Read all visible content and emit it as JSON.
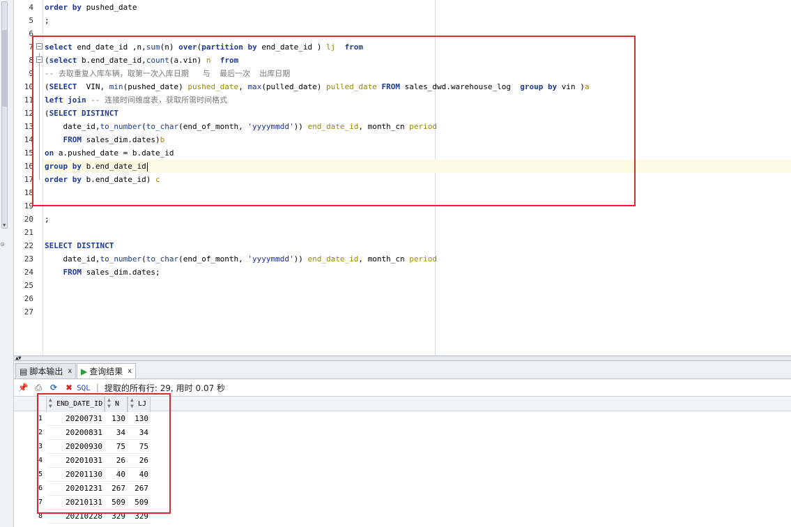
{
  "editor": {
    "lines": [
      {
        "no": "4",
        "tokens": [
          [
            "kw",
            "order by"
          ],
          [
            "t",
            " pushed_date"
          ]
        ]
      },
      {
        "no": "5",
        "tokens": [
          [
            "t",
            ";"
          ]
        ]
      },
      {
        "no": "6",
        "tokens": []
      },
      {
        "no": "7",
        "tokens": [
          [
            "kw",
            "select"
          ],
          [
            "t",
            " end_date_id ,n,"
          ],
          [
            "fn",
            "sum"
          ],
          [
            "t",
            "(n) "
          ],
          [
            "kw",
            "over"
          ],
          [
            "t",
            "("
          ],
          [
            "kw",
            "partition by"
          ],
          [
            "t",
            " end_date_id ) "
          ],
          [
            "al",
            "lj"
          ],
          [
            "t",
            "  "
          ],
          [
            "kw",
            "from"
          ]
        ]
      },
      {
        "no": "8",
        "tokens": [
          [
            "t",
            "("
          ],
          [
            "kw",
            "select"
          ],
          [
            "t",
            " b.end_date_id,"
          ],
          [
            "fn",
            "count"
          ],
          [
            "t",
            "(a.vin) "
          ],
          [
            "al",
            "n"
          ],
          [
            "t",
            "  "
          ],
          [
            "kw",
            "from"
          ]
        ]
      },
      {
        "no": "9",
        "tokens": [
          [
            "cm",
            "-- 去取重复入库车辆，取第一次入库日期   与  最后一次  出库日期"
          ]
        ]
      },
      {
        "no": "10",
        "tokens": [
          [
            "t",
            "("
          ],
          [
            "kw",
            "SELECT"
          ],
          [
            "t",
            "  VIN, "
          ],
          [
            "fn",
            "min"
          ],
          [
            "t",
            "(pushed_date) "
          ],
          [
            "al",
            "pushed_date"
          ],
          [
            "t",
            ", "
          ],
          [
            "fn",
            "max"
          ],
          [
            "t",
            "(pulled_date) "
          ],
          [
            "al",
            "pulled_date"
          ],
          [
            "t",
            " "
          ],
          [
            "kw",
            "FROM"
          ],
          [
            "t",
            " sales_dwd.warehouse_log  "
          ],
          [
            "kw",
            "group by"
          ],
          [
            "t",
            " vin )"
          ],
          [
            "al",
            "a"
          ]
        ]
      },
      {
        "no": "11",
        "tokens": [
          [
            "kw",
            "left join"
          ],
          [
            "t",
            " "
          ],
          [
            "cm",
            "-- 连接时间维度表，获取所需时间格式"
          ]
        ]
      },
      {
        "no": "12",
        "tokens": [
          [
            "t",
            "("
          ],
          [
            "kw",
            "SELECT DISTINCT"
          ]
        ]
      },
      {
        "no": "13",
        "tokens": [
          [
            "t",
            "    date_id,"
          ],
          [
            "fn",
            "to_number"
          ],
          [
            "t",
            "("
          ],
          [
            "fn",
            "to_char"
          ],
          [
            "t",
            "(end_of_month, "
          ],
          [
            "st",
            "'yyyymmdd'"
          ],
          [
            "t",
            ")) "
          ],
          [
            "al",
            "end_date_id"
          ],
          [
            "t",
            ", month_cn "
          ],
          [
            "al",
            "period"
          ]
        ]
      },
      {
        "no": "14",
        "tokens": [
          [
            "t",
            "    "
          ],
          [
            "kw",
            "FROM"
          ],
          [
            "t",
            " sales_dim.dates)"
          ],
          [
            "al",
            "b"
          ]
        ]
      },
      {
        "no": "15",
        "tokens": [
          [
            "kw",
            "on"
          ],
          [
            "t",
            " a.pushed_date = b.date_id"
          ]
        ]
      },
      {
        "no": "16",
        "tokens": [
          [
            "kw",
            "group by"
          ],
          [
            "t",
            " b.end_date_id"
          ]
        ]
      },
      {
        "no": "17",
        "tokens": [
          [
            "kw",
            "order by"
          ],
          [
            "t",
            " b.end_date_id) "
          ],
          [
            "al",
            "c"
          ]
        ]
      },
      {
        "no": "18",
        "tokens": []
      },
      {
        "no": "19",
        "tokens": []
      },
      {
        "no": "20",
        "tokens": [
          [
            "t",
            ";"
          ]
        ]
      },
      {
        "no": "21",
        "tokens": []
      },
      {
        "no": "22",
        "tokens": [
          [
            "kw",
            "SELECT DISTINCT"
          ]
        ]
      },
      {
        "no": "23",
        "tokens": [
          [
            "t",
            "    date_id,"
          ],
          [
            "fn",
            "to_number"
          ],
          [
            "t",
            "("
          ],
          [
            "fn",
            "to_char"
          ],
          [
            "t",
            "(end_of_month, "
          ],
          [
            "st",
            "'yyyymmdd'"
          ],
          [
            "t",
            ")) "
          ],
          [
            "al",
            "end_date_id"
          ],
          [
            "t",
            ", month_cn "
          ],
          [
            "al",
            "period"
          ]
        ]
      },
      {
        "no": "24",
        "tokens": [
          [
            "t",
            "    "
          ],
          [
            "kw",
            "FROM"
          ],
          [
            "t",
            " sales_dim.dates;"
          ]
        ]
      },
      {
        "no": "25",
        "tokens": []
      },
      {
        "no": "26",
        "tokens": []
      },
      {
        "no": "27",
        "tokens": []
      }
    ]
  },
  "tabs": {
    "script_output": "脚本输出",
    "query_result": "查询结果",
    "close": "x"
  },
  "toolbar": {
    "sql_label": "SQL",
    "separator": "|",
    "fetch_status": "提取的所有行: 29, 用时 0.07 秒"
  },
  "grid": {
    "columns": [
      "END_DATE_ID",
      "N",
      "LJ"
    ],
    "rows": [
      {
        "no": "1",
        "END_DATE_ID": "20200731",
        "N": "130",
        "LJ": "130"
      },
      {
        "no": "2",
        "END_DATE_ID": "20200831",
        "N": "34",
        "LJ": "34"
      },
      {
        "no": "3",
        "END_DATE_ID": "20200930",
        "N": "75",
        "LJ": "75"
      },
      {
        "no": "4",
        "END_DATE_ID": "20201031",
        "N": "26",
        "LJ": "26"
      },
      {
        "no": "5",
        "END_DATE_ID": "20201130",
        "N": "40",
        "LJ": "40"
      },
      {
        "no": "6",
        "END_DATE_ID": "20201231",
        "N": "267",
        "LJ": "267"
      },
      {
        "no": "7",
        "END_DATE_ID": "20210131",
        "N": "509",
        "LJ": "509"
      },
      {
        "no": "8",
        "END_DATE_ID": "20210228",
        "N": "329",
        "LJ": "329"
      }
    ]
  },
  "colors": {
    "highlight_box": "#e0262e",
    "keyword": "#1f3a93",
    "alias": "#9a8a00",
    "comment": "#7a7a7a"
  }
}
